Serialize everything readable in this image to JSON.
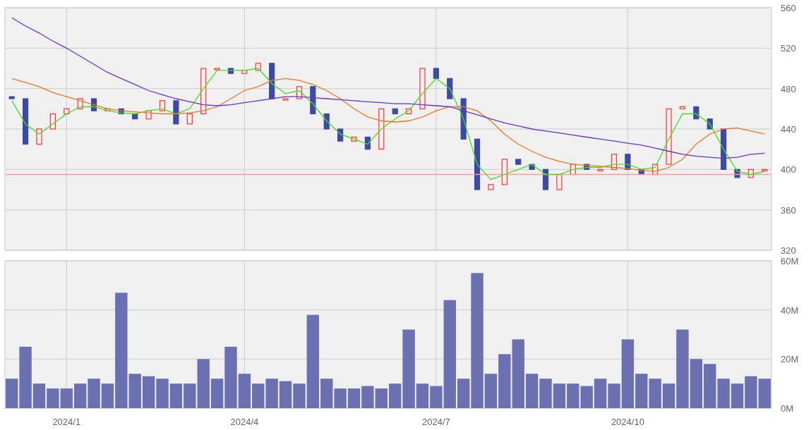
{
  "price_chart": {
    "chart_data": {
      "type": "line",
      "categories": [
        null,
        null,
        null,
        null,
        null,
        null,
        null,
        null,
        null,
        null,
        null,
        null,
        null,
        null,
        null,
        null,
        null,
        null,
        null,
        null,
        null,
        null,
        null,
        null,
        null,
        null,
        null,
        null,
        null,
        null,
        null,
        null,
        null,
        null,
        null,
        null,
        null,
        null,
        null,
        null,
        null,
        null,
        null,
        null,
        null,
        null,
        null,
        null,
        null,
        null,
        null,
        null,
        null,
        null,
        null,
        null
      ],
      "ylim": [
        320,
        560
      ],
      "grid": true,
      "yticks": [
        {
          "value": 320,
          "label": "320"
        },
        {
          "value": 360,
          "label": "360"
        },
        {
          "value": 400,
          "label": "400"
        },
        {
          "value": 440,
          "label": "440"
        },
        {
          "value": 480,
          "label": "480"
        },
        {
          "value": 520,
          "label": "520"
        },
        {
          "value": 560,
          "label": "560"
        }
      ],
      "series": [
        {
          "color": "#44dd22",
          "values": [
            468,
            445,
            435,
            445,
            455,
            462,
            462,
            458,
            456,
            455,
            458,
            460,
            455,
            460,
            480,
            498,
            498,
            498,
            500,
            485,
            475,
            478,
            465,
            448,
            435,
            430,
            425,
            440,
            450,
            458,
            475,
            490,
            480,
            450,
            405,
            390,
            395,
            400,
            405,
            395,
            395,
            400,
            402,
            402,
            405,
            405,
            400,
            402,
            430,
            455,
            455,
            445,
            420,
            398,
            395,
            398
          ]
        },
        {
          "color": "#ee7722",
          "values": [
            490,
            486,
            482,
            476,
            472,
            468,
            464,
            460,
            458,
            457,
            456,
            455,
            455,
            456,
            458,
            462,
            470,
            478,
            482,
            488,
            490,
            488,
            484,
            478,
            470,
            460,
            452,
            448,
            447,
            448,
            452,
            458,
            462,
            462,
            458,
            448,
            435,
            425,
            418,
            412,
            408,
            405,
            404,
            403,
            402,
            401,
            399,
            398,
            402,
            410,
            425,
            435,
            440,
            441,
            438,
            435
          ]
        },
        {
          "color": "#6633cc",
          "values": [
            550,
            542,
            535,
            527,
            520,
            512,
            504,
            496,
            490,
            484,
            478,
            474,
            470,
            467,
            464,
            463,
            464,
            466,
            468,
            470,
            472,
            472,
            471,
            470,
            469,
            468,
            467,
            466,
            465,
            465,
            464,
            463,
            462,
            458,
            454,
            450,
            446,
            443,
            440,
            438,
            436,
            434,
            432,
            430,
            428,
            426,
            424,
            421,
            418,
            415,
            413,
            412,
            411,
            412,
            415,
            416
          ]
        }
      ],
      "ref_lines": [
        {
          "axis": "y",
          "value": 395
        }
      ]
    }
  },
  "volume_chart": {
    "chart_data": {
      "type": "bar",
      "categories": [
        null,
        null,
        null,
        null,
        "2024/1",
        null,
        null,
        null,
        null,
        null,
        null,
        null,
        null,
        null,
        null,
        null,
        null,
        "2024/4",
        null,
        null,
        null,
        null,
        null,
        null,
        null,
        null,
        null,
        null,
        null,
        null,
        null,
        "2024/7",
        null,
        null,
        null,
        null,
        null,
        null,
        null,
        null,
        null,
        null,
        null,
        null,
        null,
        "2024/10",
        null,
        null,
        null,
        null,
        null,
        null,
        null,
        null,
        null,
        null
      ],
      "ylim": [
        0,
        60
      ],
      "grid": true,
      "yticks": [
        {
          "value": 0,
          "label": "0M"
        },
        {
          "value": 20,
          "label": "20M"
        },
        {
          "value": 40,
          "label": "40M"
        },
        {
          "value": 60,
          "label": "60M"
        }
      ],
      "series": [
        {
          "color": "#6b70b0",
          "values": [
            12,
            25,
            10,
            8,
            8,
            10,
            12,
            10,
            47,
            14,
            13,
            12,
            10,
            10,
            20,
            12,
            25,
            14,
            10,
            12,
            11,
            10,
            38,
            12,
            8,
            8,
            9,
            8,
            10,
            32,
            10,
            9,
            44,
            12,
            55,
            14,
            22,
            28,
            14,
            12,
            10,
            10,
            9,
            12,
            10,
            28,
            14,
            12,
            10,
            32,
            20,
            18,
            12,
            10,
            13,
            12
          ]
        }
      ]
    }
  }
}
